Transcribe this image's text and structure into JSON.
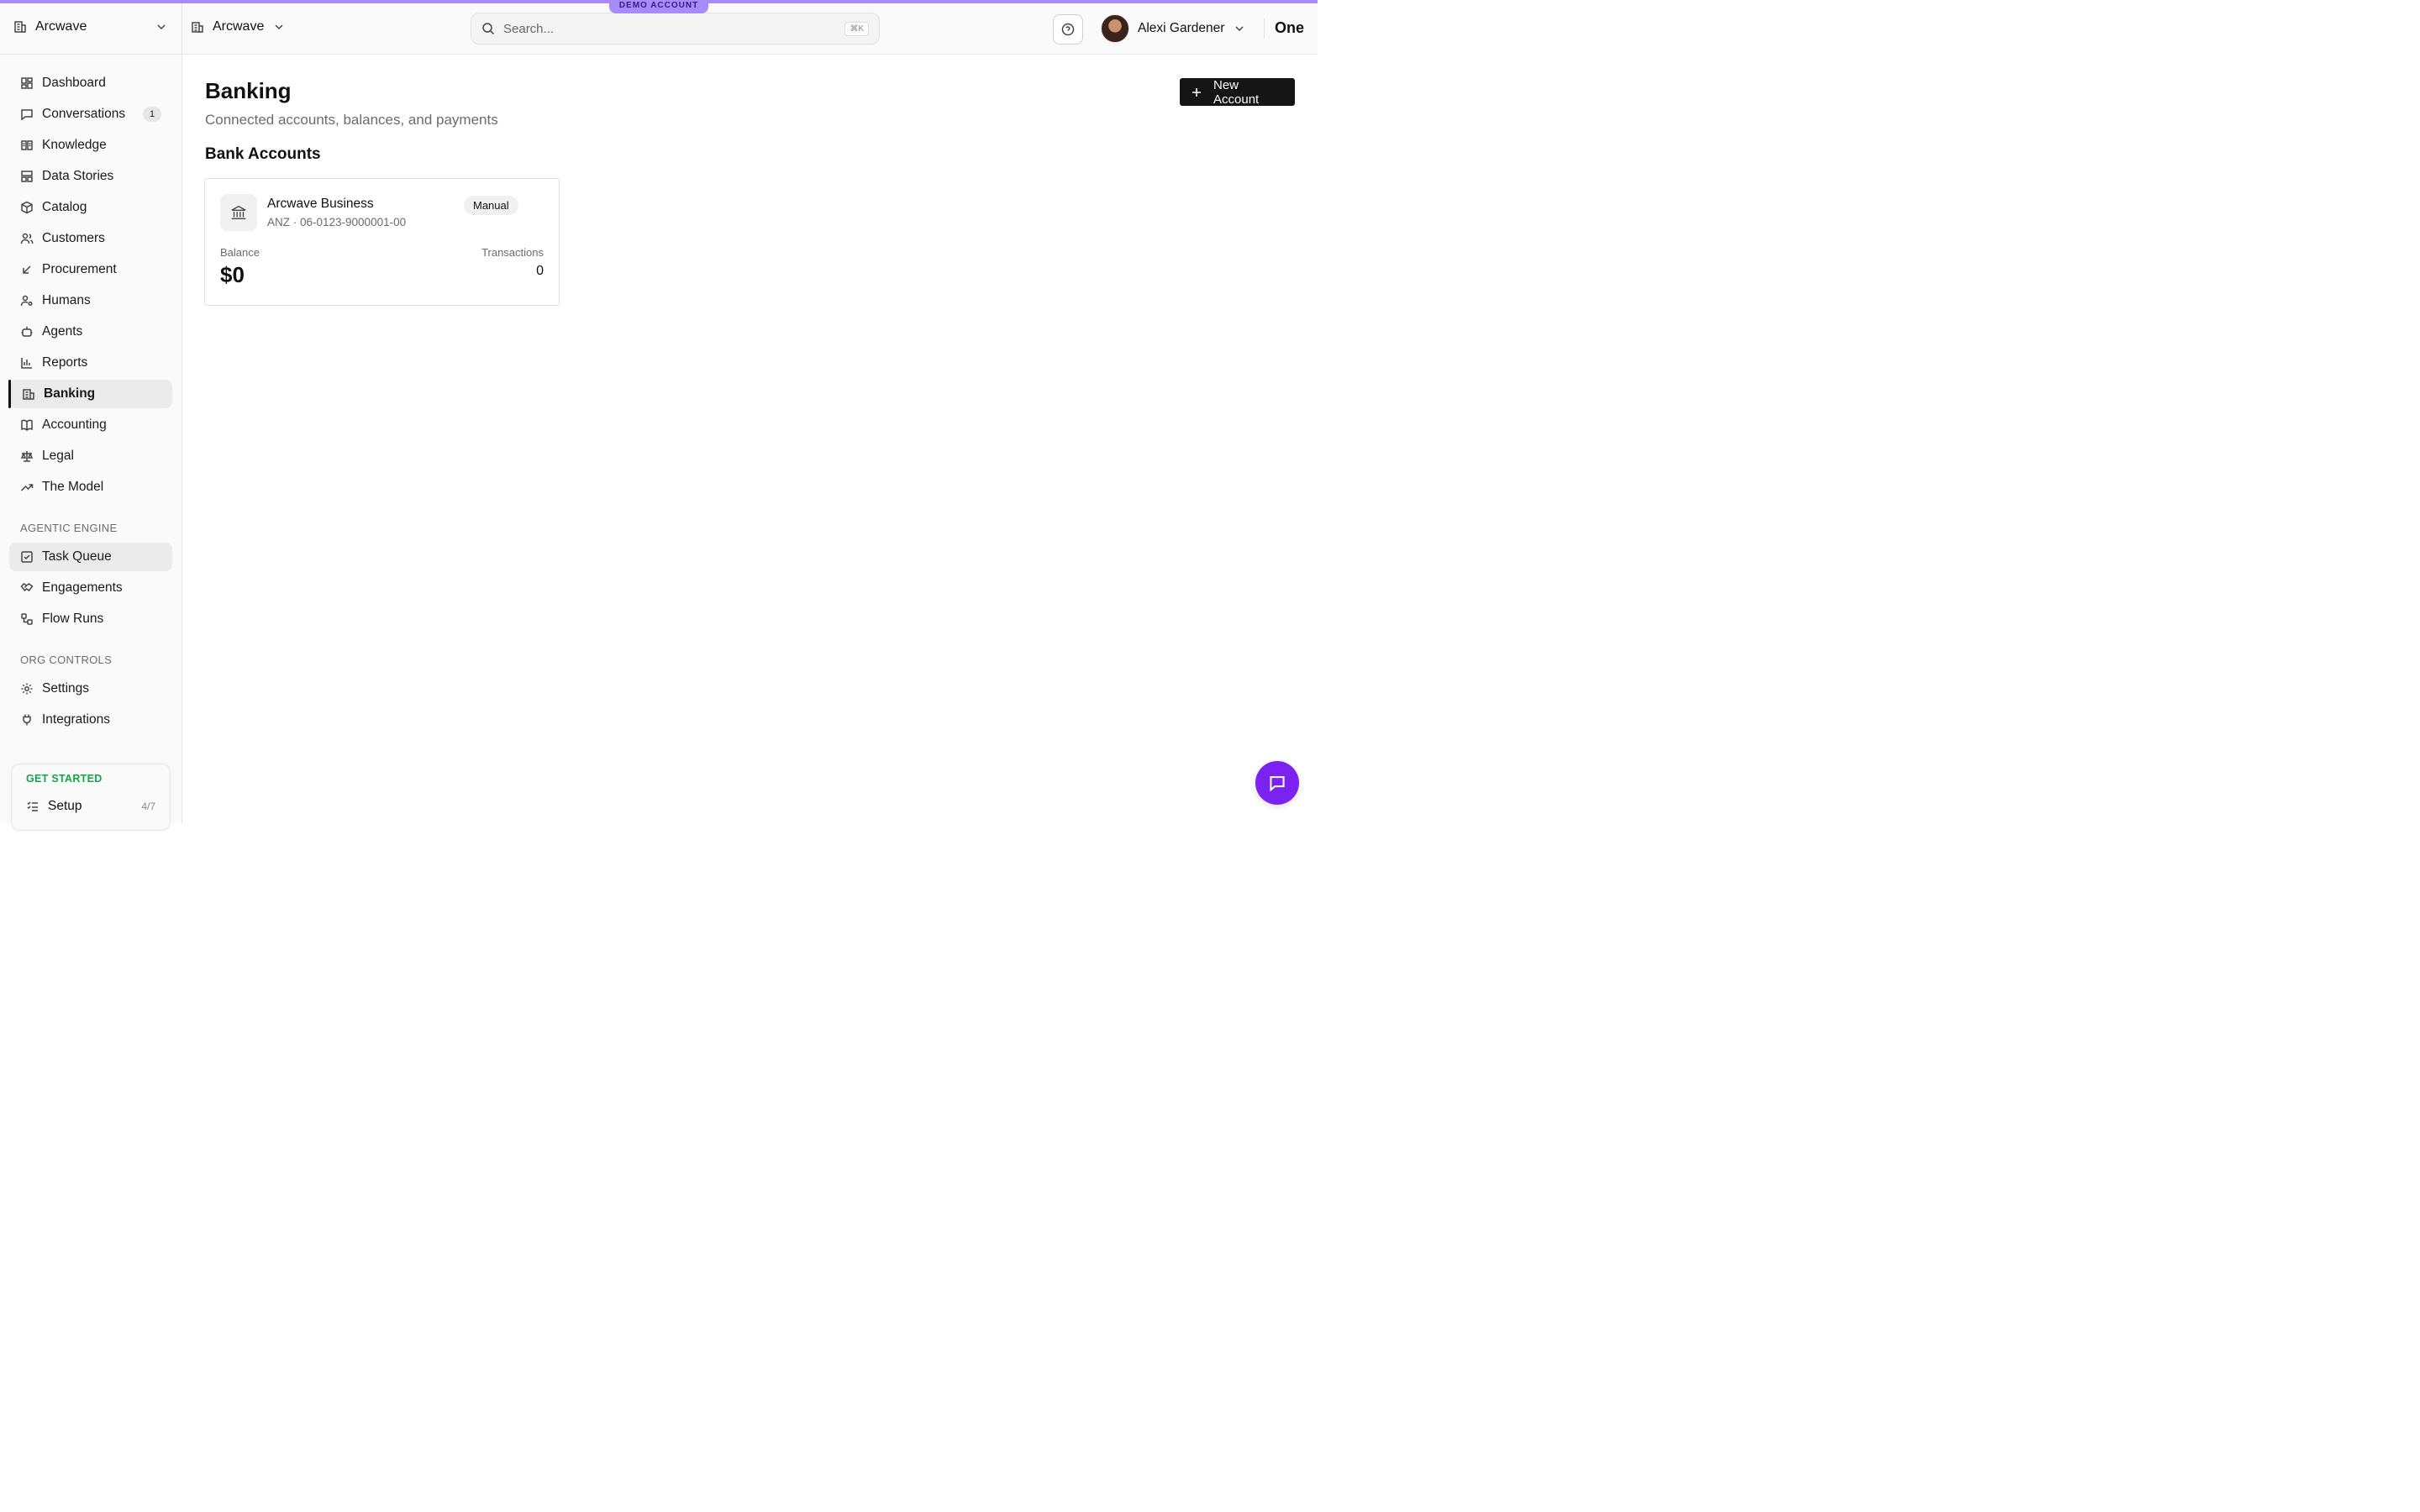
{
  "banner": {
    "label": "DEMO ACCOUNT"
  },
  "sidebar": {
    "org_name": "Arcwave",
    "items": [
      {
        "label": "Dashboard",
        "icon": "dashboard-icon"
      },
      {
        "label": "Conversations",
        "icon": "chat-icon",
        "badge": "1"
      },
      {
        "label": "Knowledge",
        "icon": "book-open-icon"
      },
      {
        "label": "Data Stories",
        "icon": "layout-icon"
      },
      {
        "label": "Catalog",
        "icon": "package-icon"
      },
      {
        "label": "Customers",
        "icon": "users-icon"
      },
      {
        "label": "Procurement",
        "icon": "arrow-down-left-icon"
      },
      {
        "label": "Humans",
        "icon": "user-cog-icon"
      },
      {
        "label": "Agents",
        "icon": "bot-icon"
      },
      {
        "label": "Reports",
        "icon": "bar-chart-icon"
      },
      {
        "label": "Banking",
        "icon": "building-icon",
        "active": true
      },
      {
        "label": "Accounting",
        "icon": "book-icon"
      },
      {
        "label": "Legal",
        "icon": "scale-icon"
      },
      {
        "label": "The Model",
        "icon": "trending-up-icon"
      }
    ],
    "agentic_title": "AGENTIC ENGINE",
    "agentic_items": [
      {
        "label": "Task Queue",
        "icon": "check-square-icon"
      },
      {
        "label": "Engagements",
        "icon": "handshake-icon"
      },
      {
        "label": "Flow Runs",
        "icon": "workflow-icon"
      }
    ],
    "org_title": "ORG CONTROLS",
    "org_items": [
      {
        "label": "Settings",
        "icon": "gear-icon"
      },
      {
        "label": "Integrations",
        "icon": "plug-icon"
      }
    ],
    "get_started": {
      "title": "GET STARTED",
      "label": "Setup",
      "progress": "4/7"
    }
  },
  "topbar": {
    "org_name": "Arcwave",
    "search_placeholder": "Search...",
    "shortcut": "⌘K",
    "user_name": "Alexi Gardener",
    "brand": "One"
  },
  "main": {
    "title": "Banking",
    "subtitle": "Connected accounts, balances, and payments",
    "new_button": "New Account",
    "section": "Bank Accounts",
    "accounts": [
      {
        "name": "Arcwave Business",
        "number": "ANZ · 06-0123-9000001-00",
        "status": "Manual",
        "balance_label": "Balance",
        "balance": "$0",
        "transactions_label": "Transactions",
        "transactions": "0"
      }
    ]
  },
  "colors": {
    "accent": "#7c22f0",
    "banner": "#a78bfa",
    "get_started": "#16a34a"
  }
}
